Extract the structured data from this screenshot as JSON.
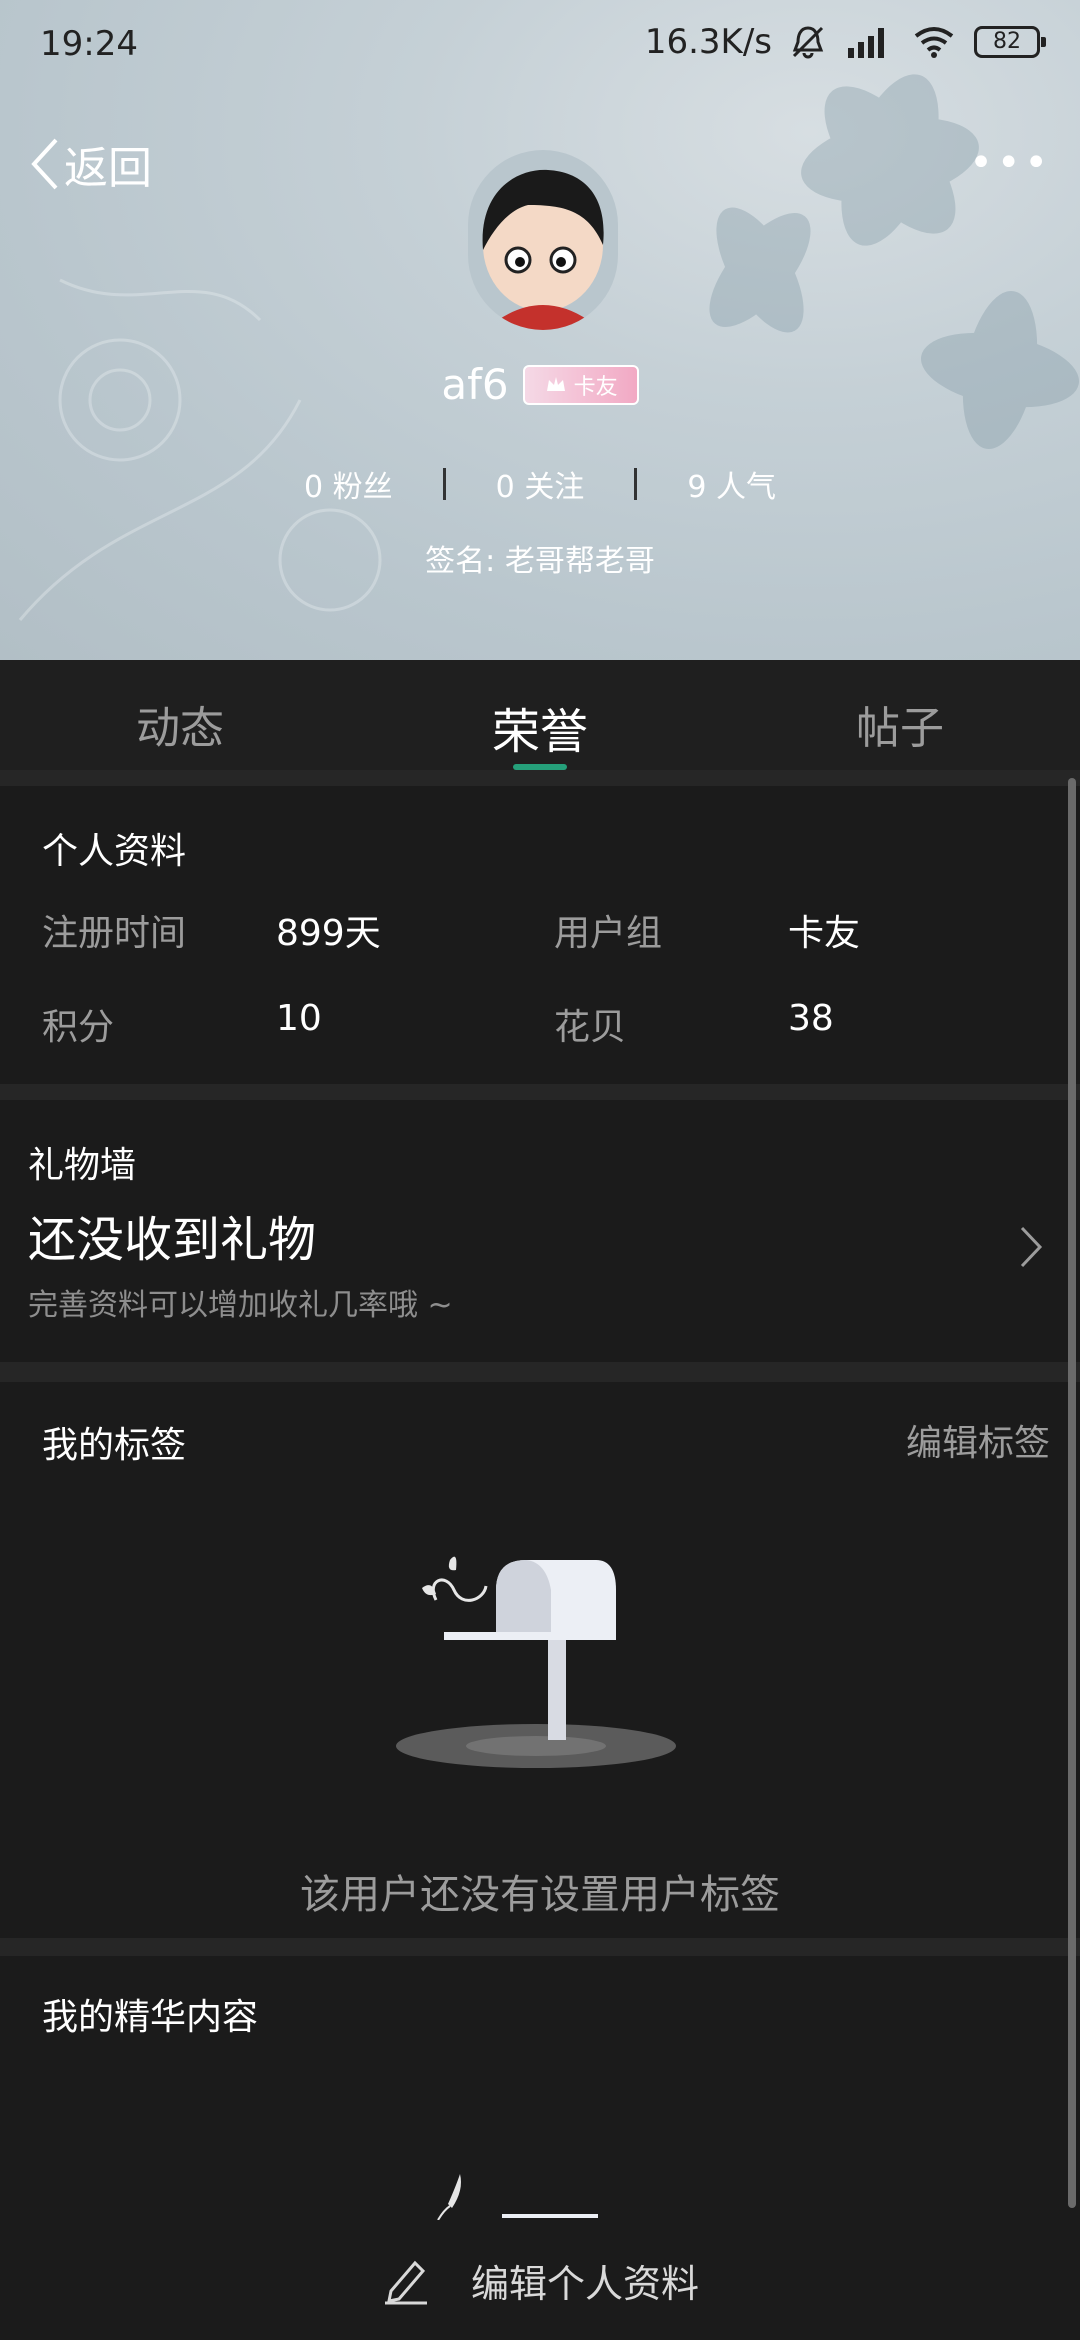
{
  "status": {
    "time": "19:24",
    "speed": "16.3K/s",
    "battery": "82"
  },
  "header": {
    "back_label": "返回",
    "more_icon": "more-icon",
    "username": "af6",
    "badge_label": "卡友",
    "stats": [
      {
        "value": "0",
        "label": "粉丝"
      },
      {
        "value": "0",
        "label": "关注"
      },
      {
        "value": "9",
        "label": "人气"
      }
    ],
    "signature": "签名: 老哥帮老哥"
  },
  "tabs": [
    {
      "label": "动态",
      "active": false
    },
    {
      "label": "荣誉",
      "active": true
    },
    {
      "label": "帖子",
      "active": false
    }
  ],
  "profile": {
    "title": "个人资料",
    "rows": [
      {
        "label1": "注册时间",
        "value1": "899天",
        "label2": "用户组",
        "value2": "卡友"
      },
      {
        "label1": "积分",
        "value1": "10",
        "label2": "花贝",
        "value2": "38"
      }
    ]
  },
  "gifts": {
    "title": "礼物墙",
    "main": "还没收到礼物",
    "sub": "完善资料可以增加收礼几率哦 ~"
  },
  "tags": {
    "title": "我的标签",
    "edit_label": "编辑标签",
    "empty_text": "该用户还没有设置用户标签"
  },
  "featured": {
    "title": "我的精华内容"
  },
  "bottom": {
    "edit_profile_label": "编辑个人资料"
  },
  "colors": {
    "accent": "#25a07a",
    "background": "#1b1b1b"
  }
}
